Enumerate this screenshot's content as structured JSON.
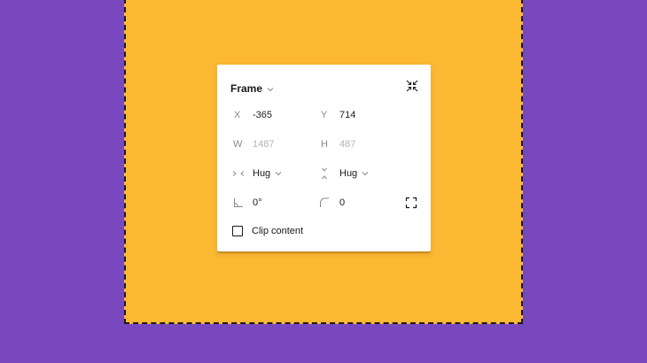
{
  "colors": {
    "background": "#7A48BE",
    "frame_fill": "#FBB833",
    "panel": "#FFFFFF",
    "text": "#1A1A1A",
    "muted_text": "#B3B3B3",
    "label": "#8A8A8A"
  },
  "panel": {
    "title": "Frame",
    "title_icon": "chevron-down-icon",
    "collapse_icon": "collapse-arrows-icon",
    "position": {
      "x_label": "X",
      "x_value": "-365",
      "y_label": "Y",
      "y_value": "714"
    },
    "size": {
      "w_label": "W",
      "w_value": "1487",
      "h_label": "H",
      "h_value": "487"
    },
    "resizing": {
      "horizontal_icon": "horizontal-hug-icon",
      "horizontal_value": "Hug",
      "vertical_icon": "vertical-hug-icon",
      "vertical_value": "Hug"
    },
    "rotation": {
      "icon": "rotation-angle-icon",
      "value": "0°"
    },
    "corner_radius": {
      "icon": "corner-radius-icon",
      "value": "0"
    },
    "independent_corners_icon": "independent-corners-icon",
    "clip_content": {
      "label": "Clip content",
      "checked": false
    }
  }
}
